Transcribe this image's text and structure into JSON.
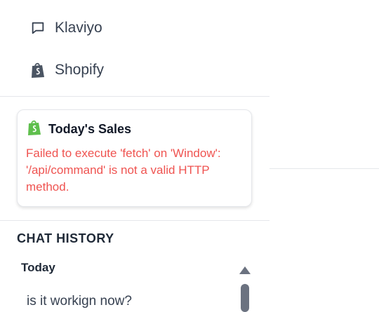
{
  "sidebar": {
    "integrations": [
      {
        "label": "Klaviyo",
        "icon": "chat-bubble-icon"
      },
      {
        "label": "Shopify",
        "icon": "shopify-bag-icon"
      }
    ]
  },
  "sales_card": {
    "title": "Today's Sales",
    "icon": "shopify-bag-icon",
    "error": "Failed to execute 'fetch' on 'Window': '/api/command' is not a valid HTTP method.",
    "error_color": "#ef5350",
    "brand_color": "#5fbf4d"
  },
  "chat_history": {
    "title": "CHAT HISTORY",
    "groups": [
      {
        "label": "Today",
        "items": [
          "is it workign now?"
        ]
      }
    ]
  }
}
